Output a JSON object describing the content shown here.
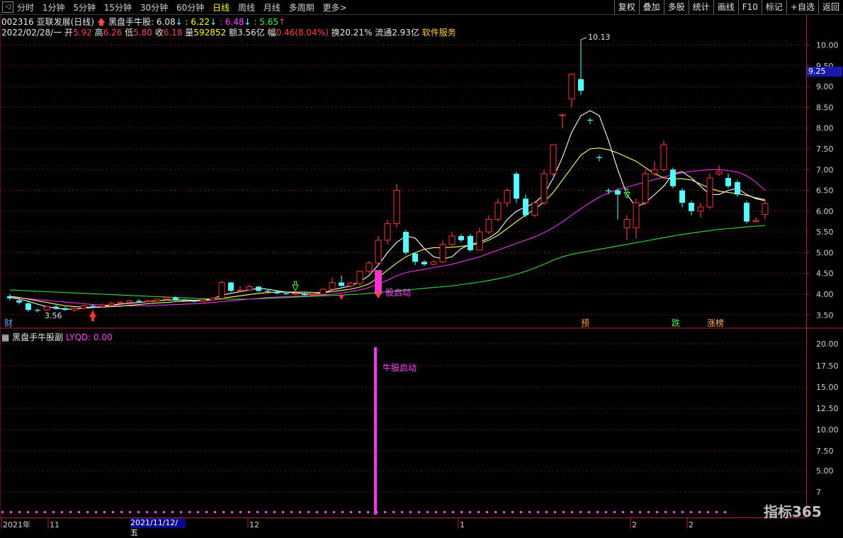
{
  "topbar": {
    "back_icon": "◁",
    "periods": [
      "分时",
      "1分钟",
      "5分钟",
      "15分钟",
      "30分钟",
      "60分钟",
      "日线",
      "周线",
      "月线",
      "多周期",
      "更多>"
    ],
    "active_period": "日线",
    "tools": [
      "复权",
      "叠加",
      "多股",
      "统计",
      "画线",
      "F10",
      "标记",
      "+自选",
      "返回"
    ]
  },
  "quote": {
    "code_name": "002316 亚联发展(日线)",
    "indicator_name": "黑盘手牛股",
    "v1": ": 6.08",
    "v2": ": 6.22",
    "v3": ": 6.48",
    "v4": ": 5.65",
    "date": "2022/02/28/一",
    "open_l": "开",
    "open": "5.92",
    "high_l": "高",
    "high": "6.26",
    "low_l": "低",
    "low": "5.80",
    "close_l": "收",
    "close": "6.18",
    "vol_l": "量",
    "vol": "592852",
    "amt_l": "额",
    "amt": "3.56亿",
    "chg_l": "幅",
    "chg": "0.46(8.04%)",
    "turn_l": "换",
    "turn": "20.21%",
    "float_l": "流通",
    "float": "2.93亿",
    "sector": "软件服务"
  },
  "sub": {
    "title": "黑盘手牛股副",
    "lyqd_label": "LYQD:",
    "lyqd_value": "0.00",
    "signal_text": "牛股启动"
  },
  "price_axis": {
    "ticks": [
      "10.00",
      "9.50",
      "9.00",
      "8.50",
      "8.00",
      "7.50",
      "7.00",
      "6.50",
      "6.00",
      "5.50",
      "5.00",
      "4.50",
      "4.00",
      "3.50"
    ],
    "current": "9.25"
  },
  "sub_axis": {
    "ticks": [
      "20.00",
      "17.50",
      "15.00",
      "12.50",
      "10.00",
      "7.50",
      "5.00",
      "7"
    ]
  },
  "annotations": {
    "max": "10.13",
    "min": "3.56",
    "signal": "股启动",
    "badge_cai": "财",
    "badge_yu": "预",
    "badge_die": "跌",
    "badge_zt": "涨榜"
  },
  "date_axis": {
    "labels": [
      "2021年",
      "11",
      "12",
      "1",
      "2",
      "2"
    ],
    "cursor": "2021/11/12/五"
  },
  "watermark": "指标365",
  "chart_data": {
    "type": "candlestick",
    "ylim": [
      3.3,
      10.3
    ],
    "candles": [
      [
        3.95,
        3.9,
        4.0,
        3.85
      ],
      [
        3.85,
        3.8,
        3.9,
        3.75
      ],
      [
        3.78,
        3.62,
        3.82,
        3.58
      ],
      [
        3.62,
        3.6,
        3.66,
        3.56
      ],
      [
        3.62,
        3.7,
        3.72,
        3.6
      ],
      [
        3.7,
        3.65,
        3.74,
        3.62
      ],
      [
        3.66,
        3.62,
        3.7,
        3.6
      ],
      [
        3.62,
        3.66,
        3.68,
        3.58
      ],
      [
        3.66,
        3.72,
        3.75,
        3.64
      ],
      [
        3.72,
        3.7,
        3.76,
        3.68
      ],
      [
        3.7,
        3.74,
        3.78,
        3.68
      ],
      [
        3.74,
        3.78,
        3.82,
        3.72
      ],
      [
        3.78,
        3.8,
        3.84,
        3.76
      ],
      [
        3.8,
        3.84,
        3.86,
        3.78
      ],
      [
        3.84,
        3.82,
        3.88,
        3.8
      ],
      [
        3.82,
        3.84,
        3.86,
        3.8
      ],
      [
        3.84,
        3.88,
        3.9,
        3.82
      ],
      [
        3.88,
        3.92,
        3.94,
        3.86
      ],
      [
        3.92,
        3.86,
        3.95,
        3.84
      ],
      [
        3.86,
        3.84,
        3.88,
        3.82
      ],
      [
        3.84,
        3.82,
        3.86,
        3.8
      ],
      [
        3.82,
        3.86,
        3.88,
        3.8
      ],
      [
        3.86,
        3.9,
        3.92,
        3.84
      ],
      [
        3.9,
        4.28,
        4.32,
        3.88
      ],
      [
        4.28,
        4.08,
        4.3,
        4.05
      ],
      [
        4.08,
        4.1,
        4.2,
        4.05
      ],
      [
        4.1,
        4.18,
        4.22,
        4.08
      ],
      [
        4.18,
        4.08,
        4.2,
        4.05
      ],
      [
        4.08,
        4.06,
        4.12,
        4.02
      ],
      [
        4.06,
        4.02,
        4.1,
        4.0
      ],
      [
        4.02,
        4.0,
        4.06,
        3.98
      ],
      [
        4.0,
        4.02,
        4.05,
        3.98
      ],
      [
        4.02,
        3.98,
        4.04,
        3.96
      ],
      [
        3.98,
        4.0,
        4.04,
        3.96
      ],
      [
        4.0,
        4.12,
        4.14,
        3.98
      ],
      [
        4.12,
        4.28,
        4.4,
        4.1
      ],
      [
        4.28,
        4.2,
        4.45,
        4.18
      ],
      [
        4.2,
        4.26,
        4.3,
        4.16
      ],
      [
        4.26,
        4.55,
        4.55,
        4.2
      ],
      [
        4.55,
        4.75,
        4.8,
        4.5
      ],
      [
        4.75,
        5.3,
        5.4,
        4.7
      ],
      [
        5.3,
        5.7,
        5.8,
        5.2
      ],
      [
        5.7,
        6.5,
        6.65,
        5.6
      ],
      [
        5.5,
        5.0,
        5.55,
        4.95
      ],
      [
        4.98,
        4.78,
        5.0,
        4.7
      ],
      [
        4.78,
        4.72,
        4.82,
        4.68
      ],
      [
        4.72,
        4.78,
        4.82,
        4.7
      ],
      [
        4.78,
        5.2,
        5.3,
        4.75
      ],
      [
        5.2,
        5.4,
        5.5,
        5.15
      ],
      [
        5.4,
        5.3,
        5.45,
        5.25
      ],
      [
        5.4,
        5.06,
        5.45,
        5.02
      ],
      [
        5.06,
        5.5,
        5.6,
        5.05
      ],
      [
        5.5,
        5.8,
        5.9,
        5.45
      ],
      [
        5.8,
        6.2,
        6.3,
        5.75
      ],
      [
        6.2,
        6.5,
        6.55,
        6.1
      ],
      [
        6.9,
        6.3,
        6.95,
        6.2
      ],
      [
        6.3,
        5.9,
        6.4,
        5.85
      ],
      [
        5.9,
        6.2,
        6.25,
        5.85
      ],
      [
        6.2,
        6.9,
        7.0,
        6.15
      ],
      [
        6.9,
        7.6,
        7.6,
        6.85
      ],
      [
        8.3,
        8.32,
        8.35,
        8.0
      ],
      [
        8.7,
        9.3,
        9.3,
        8.5
      ],
      [
        9.18,
        8.9,
        10.13,
        8.8
      ],
      [
        8.2,
        8.18,
        8.25,
        8.1
      ],
      [
        7.3,
        7.28,
        7.35,
        7.2
      ],
      [
        6.5,
        6.48,
        6.55,
        6.4
      ],
      [
        6.5,
        6.4,
        6.55,
        5.8
      ],
      [
        5.6,
        5.8,
        5.9,
        5.3
      ],
      [
        5.6,
        6.2,
        6.3,
        5.35
      ],
      [
        6.2,
        6.9,
        7.0,
        6.15
      ],
      [
        6.9,
        7.0,
        7.2,
        6.85
      ],
      [
        7.0,
        7.6,
        7.7,
        6.95
      ],
      [
        7.0,
        6.6,
        7.05,
        6.55
      ],
      [
        6.5,
        6.2,
        6.55,
        6.1
      ],
      [
        6.2,
        6.0,
        6.25,
        5.9
      ],
      [
        6.0,
        6.1,
        6.2,
        5.85
      ],
      [
        6.1,
        6.8,
        6.9,
        6.05
      ],
      [
        6.9,
        6.95,
        7.1,
        6.85
      ],
      [
        6.8,
        6.6,
        6.9,
        6.55
      ],
      [
        6.7,
        6.4,
        6.75,
        6.35
      ],
      [
        6.2,
        5.75,
        6.25,
        5.7
      ],
      [
        5.75,
        5.78,
        5.85,
        5.72
      ],
      [
        5.92,
        6.18,
        6.26,
        5.8
      ]
    ],
    "ma5": [
      3.92,
      3.88,
      3.83,
      3.76,
      3.7,
      3.66,
      3.64,
      3.64,
      3.66,
      3.68,
      3.7,
      3.74,
      3.76,
      3.78,
      3.8,
      3.82,
      3.84,
      3.86,
      3.86,
      3.86,
      3.85,
      3.86,
      3.88,
      3.98,
      4.02,
      4.06,
      4.1,
      4.14,
      4.12,
      4.08,
      4.05,
      4.03,
      4.01,
      4.0,
      4.03,
      4.1,
      4.15,
      4.2,
      4.3,
      4.45,
      4.7,
      5.0,
      5.25,
      5.4,
      5.35,
      5.1,
      4.9,
      4.85,
      4.9,
      5.1,
      5.2,
      5.25,
      5.35,
      5.5,
      5.8,
      6.0,
      6.1,
      6.2,
      6.4,
      6.8,
      7.3,
      7.9,
      8.3,
      8.42,
      8.3,
      7.7,
      7.0,
      6.4,
      6.1,
      6.2,
      6.4,
      6.6,
      6.9,
      6.95,
      6.8,
      6.6,
      6.4,
      6.4,
      6.5,
      6.55,
      6.4,
      6.3,
      6.25
    ],
    "ma10": [
      3.95,
      3.92,
      3.88,
      3.84,
      3.8,
      3.76,
      3.72,
      3.7,
      3.69,
      3.68,
      3.69,
      3.7,
      3.71,
      3.73,
      3.75,
      3.77,
      3.79,
      3.8,
      3.82,
      3.83,
      3.84,
      3.85,
      3.86,
      3.9,
      3.93,
      3.96,
      3.99,
      4.02,
      4.04,
      4.05,
      4.05,
      4.05,
      4.05,
      4.04,
      4.04,
      4.06,
      4.09,
      4.12,
      4.17,
      4.25,
      4.4,
      4.58,
      4.75,
      4.9,
      5.0,
      5.08,
      5.12,
      5.12,
      5.13,
      5.15,
      5.18,
      5.22,
      5.3,
      5.42,
      5.58,
      5.75,
      5.9,
      6.05,
      6.22,
      6.45,
      6.75,
      7.05,
      7.35,
      7.5,
      7.52,
      7.48,
      7.4,
      7.3,
      7.2,
      7.05,
      6.9,
      6.8,
      6.78,
      6.78,
      6.75,
      6.65,
      6.55,
      6.48,
      6.45,
      6.42,
      6.38,
      6.32,
      6.28
    ],
    "ma20": [
      3.92,
      3.91,
      3.89,
      3.87,
      3.85,
      3.83,
      3.81,
      3.79,
      3.77,
      3.75,
      3.74,
      3.73,
      3.72,
      3.72,
      3.72,
      3.72,
      3.73,
      3.74,
      3.75,
      3.76,
      3.77,
      3.78,
      3.8,
      3.82,
      3.84,
      3.86,
      3.88,
      3.9,
      3.92,
      3.93,
      3.94,
      3.95,
      3.96,
      3.97,
      3.98,
      4.0,
      4.03,
      4.06,
      4.1,
      4.16,
      4.24,
      4.34,
      4.44,
      4.52,
      4.56,
      4.6,
      4.64,
      4.68,
      4.72,
      4.78,
      4.84,
      4.9,
      4.98,
      5.06,
      5.14,
      5.22,
      5.3,
      5.38,
      5.48,
      5.6,
      5.74,
      5.9,
      6.06,
      6.2,
      6.34,
      6.44,
      6.52,
      6.58,
      6.64,
      6.7,
      6.76,
      6.82,
      6.88,
      6.92,
      6.96,
      6.98,
      7.0,
      7.0,
      6.98,
      6.94,
      6.85,
      6.7,
      6.5
    ],
    "ma60": [
      4.1,
      4.09,
      4.08,
      4.07,
      4.06,
      4.05,
      4.04,
      4.03,
      4.02,
      4.01,
      4.0,
      3.99,
      3.98,
      3.97,
      3.96,
      3.95,
      3.94,
      3.93,
      3.92,
      3.91,
      3.9,
      3.89,
      3.88,
      3.88,
      3.88,
      3.88,
      3.88,
      3.89,
      3.9,
      3.91,
      3.92,
      3.93,
      3.94,
      3.95,
      3.96,
      3.97,
      3.98,
      3.99,
      4.0,
      4.02,
      4.04,
      4.06,
      4.08,
      4.1,
      4.12,
      4.14,
      4.16,
      4.18,
      4.2,
      4.23,
      4.26,
      4.29,
      4.33,
      4.37,
      4.42,
      4.48,
      4.55,
      4.63,
      4.72,
      4.82,
      4.9,
      4.96,
      5.0,
      5.04,
      5.08,
      5.12,
      5.16,
      5.2,
      5.24,
      5.28,
      5.32,
      5.36,
      5.4,
      5.44,
      5.47,
      5.5,
      5.53,
      5.56,
      5.58,
      5.6,
      5.62,
      5.64,
      5.65
    ],
    "sub_bar": {
      "value": 20.0,
      "ylim": [
        0,
        21
      ]
    }
  }
}
